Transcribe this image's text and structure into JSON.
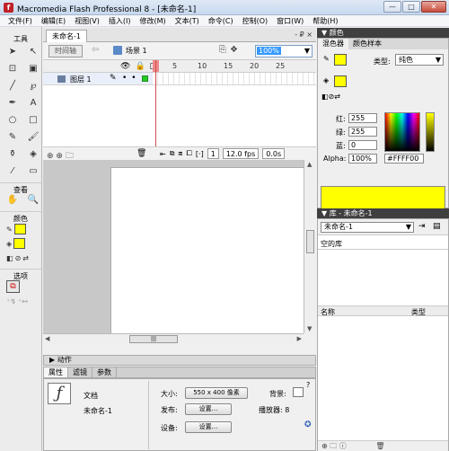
{
  "window": {
    "title": "Macromedia Flash Professional 8 - [未命名-1]",
    "icon": "flash-app-icon",
    "minimize_glyph": "—",
    "maximize_glyph": "□",
    "close_glyph": "✕"
  },
  "menu": [
    "文件(F)",
    "编辑(E)",
    "视图(V)",
    "插入(I)",
    "修改(M)",
    "文本(T)",
    "命令(C)",
    "控制(O)",
    "窗口(W)",
    "帮助(H)"
  ],
  "tools": {
    "header": "工具",
    "view_header": "查看",
    "color_header": "颜色",
    "options_header": "选项"
  },
  "document": {
    "tab": "未命名-1",
    "tab_controls": "- ₽ ×",
    "timeline_button": "时间轴",
    "scene": "场景 1",
    "zoom": "100%"
  },
  "timeline": {
    "ruler": [
      "5",
      "10",
      "15",
      "20",
      "25"
    ],
    "layer_name": "图层 1",
    "frame": "1",
    "fps": "12.0 fps",
    "time": "0.0s"
  },
  "panels": {
    "actions": "▶ 动作",
    "properties_tabs": [
      "属性",
      "滤镜",
      "参数"
    ]
  },
  "properties": {
    "doc_label": "文档",
    "doc_name": "未命名-1",
    "size_label": "大小:",
    "size_value": "550 x 400 像素",
    "background_label": "背景:",
    "publish_label": "发布:",
    "settings_button": "设置...",
    "player_label": "播放器: 8",
    "device_label": "设备:",
    "device_settings_button": "设置..."
  },
  "color_panel": {
    "title": "▼ 颜色",
    "tabs": [
      "混色器",
      "颜色样本"
    ],
    "type_label": "类型:",
    "type_value": "纯色",
    "red_label": "红:",
    "red_value": "255",
    "green_label": "绿:",
    "green_value": "255",
    "blue_label": "蓝:",
    "blue_value": "0",
    "alpha_label": "Alpha:",
    "alpha_value": "100%",
    "hex_value": "#FFFF00",
    "fill_color": "#ffff00"
  },
  "library_panel": {
    "title": "▼ 库 - 未命名-1",
    "document_select": "未命名-1",
    "empty_label": "空的库",
    "col_name": "名称",
    "col_type": "类型"
  }
}
